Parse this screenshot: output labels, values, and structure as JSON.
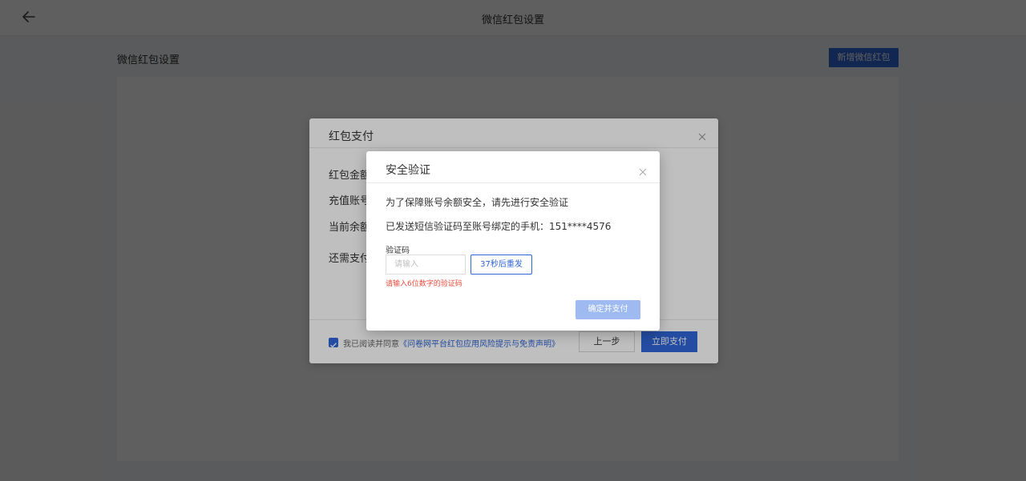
{
  "topbar": {
    "title": "微信红包设置"
  },
  "page": {
    "title": "微信红包设置",
    "new_button": "新增微信红包"
  },
  "pay_dialog": {
    "title": "红包支付",
    "rows": [
      "红包金额",
      "充值账号",
      "当前余额",
      "还需支付"
    ],
    "agree_prefix": "我已阅读并同意",
    "agree_link": "《问卷网平台红包应用风险提示与免责声明》",
    "agree_checked": true,
    "prev_button": "上一步",
    "pay_button": "立即支付"
  },
  "security_dialog": {
    "title": "安全验证",
    "line1": "为了保障账号余额安全，请先进行安全验证",
    "line2": "已发送短信验证码至账号绑定的手机：151****4576",
    "code_label": "验证码",
    "code_placeholder": "请输入",
    "code_value": "",
    "resend_button": "37秒后重发",
    "error": "请输入6位数字的验证码",
    "confirm_button": "确定并支付"
  },
  "colors": {
    "primary": "#2f66d8",
    "error": "#e84c3d",
    "disabled_primary": "#9ebaf0"
  }
}
